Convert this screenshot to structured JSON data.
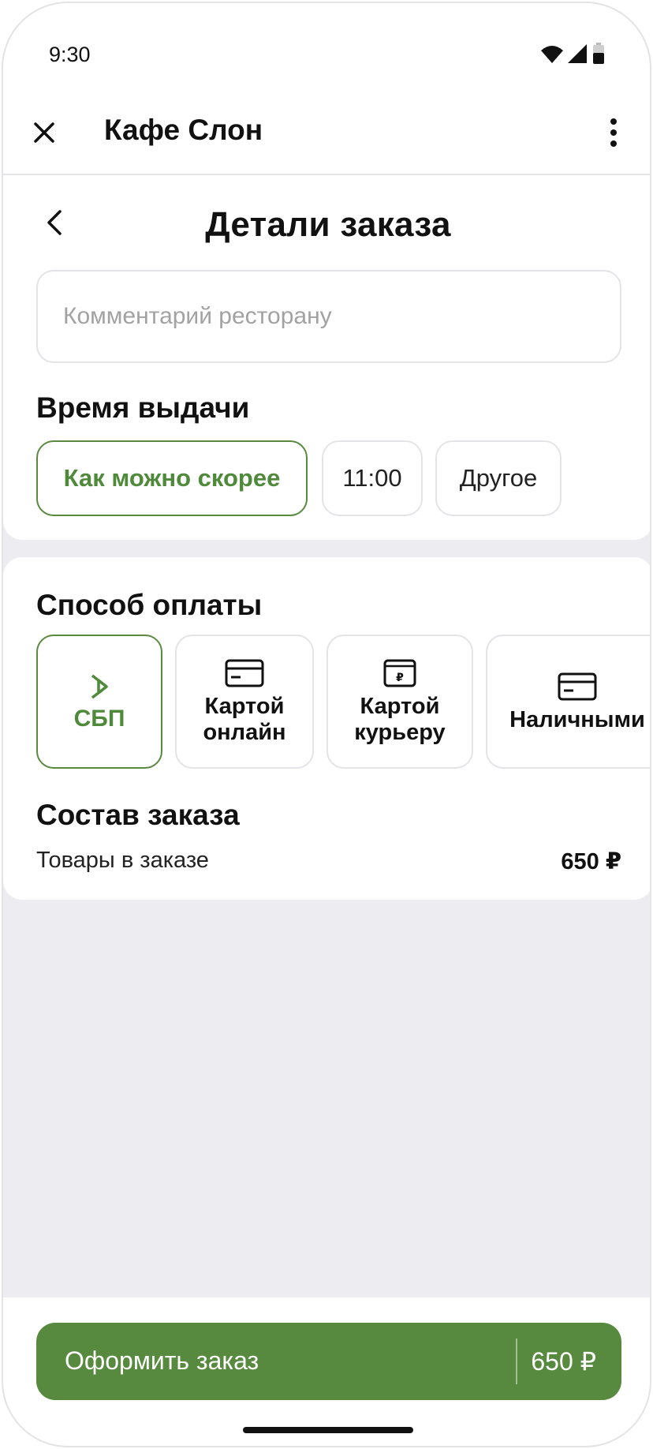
{
  "status_bar": {
    "time": "9:30",
    "icons": [
      "wifi-icon",
      "signal-icon",
      "battery-icon"
    ]
  },
  "app_bar": {
    "title": "Кафе Слон",
    "close_icon": "close-icon",
    "menu_icon": "more-vertical-icon"
  },
  "page": {
    "title": "Детали заказа",
    "back_icon": "chevron-left-icon"
  },
  "comment": {
    "placeholder": "Комментарий ресторану",
    "value": ""
  },
  "pickup_time": {
    "title": "Время выдачи",
    "options": [
      {
        "label": "Как можно скорее",
        "selected": true
      },
      {
        "label": "11:00",
        "selected": false
      },
      {
        "label": "Другое",
        "selected": false
      }
    ]
  },
  "payment": {
    "title": "Способ оплаты",
    "methods": [
      {
        "label": "СБП",
        "icon": "sbp-icon",
        "selected": true
      },
      {
        "label": "Картой\nонлайн",
        "icon": "credit-card-icon",
        "selected": false
      },
      {
        "label": "Картой\nкурьеру",
        "icon": "wallet-ruble-icon",
        "selected": false
      },
      {
        "label": "Наличными",
        "icon": "cash-card-icon",
        "selected": false
      }
    ]
  },
  "order_summary": {
    "title": "Состав заказа",
    "items_label": "Товары в заказе",
    "items_total": "650 ₽"
  },
  "checkout": {
    "button_label": "Оформить заказ",
    "price": "650 ₽"
  },
  "colors": {
    "accent": "#578a3e",
    "accent_text": "#4e8a3a",
    "background": "#ededf1",
    "border": "#e4e4e8"
  }
}
